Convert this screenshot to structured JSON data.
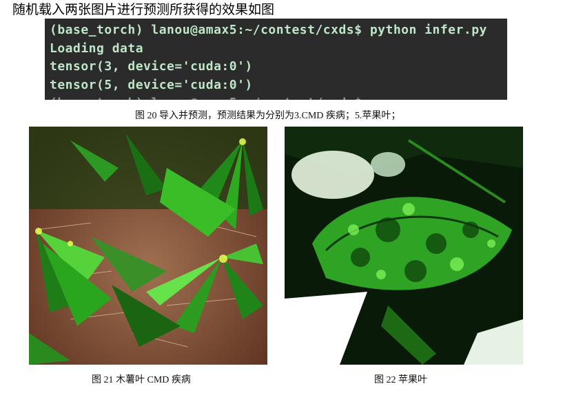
{
  "heading": "随机载入两张图片进行预测所获得的效果如图",
  "terminal": {
    "lines": [
      "(base_torch) lanou@amax5:~/contest/cxds$ python infer.py",
      "Loading data",
      "tensor(3, device='cuda:0')",
      "tensor(5, device='cuda:0')"
    ]
  },
  "figure20_caption": "图 20 导入并预测，预测结果为分别为3.CMD 疾病；5.苹果叶；",
  "figure21_caption": "图 21 木薯叶 CMD 疾病",
  "figure22_caption": "图 22  苹果叶",
  "photos": {
    "left": "cassava-leaves-photo",
    "right": "apple-leaf-photo"
  },
  "colors": {
    "terminal_bg": "#2b2b2b",
    "terminal_text": "#bfe6c8"
  }
}
